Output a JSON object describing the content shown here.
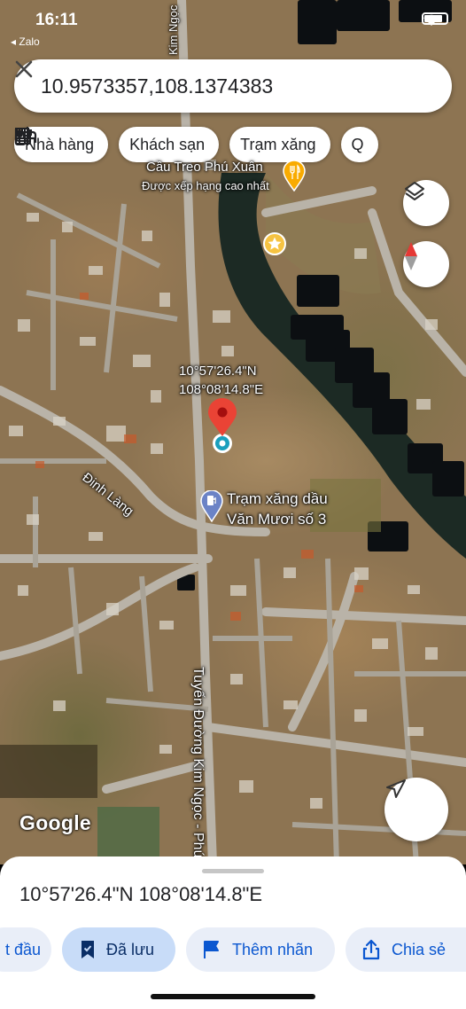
{
  "status_bar": {
    "time": "16:11",
    "back_app": "◂ Zalo"
  },
  "search": {
    "query": "10.9573357,108.1374383"
  },
  "chips": [
    {
      "label": "Nhà hàng",
      "icon": "restaurant-icon"
    },
    {
      "label": "Khách sạn",
      "icon": "hotel-icon"
    },
    {
      "label": "Trạm xăng",
      "icon": "gas-station-icon"
    },
    {
      "label": "Q",
      "icon": "coffee-icon"
    }
  ],
  "map": {
    "type": "satellite",
    "place": {
      "title": "Cầu Treo Phú Xuân",
      "subtitle": "Được xếp hạng cao nhất"
    },
    "pin_label": {
      "line1": "10°57'26.4\"N",
      "line2": "108°08'14.8\"E"
    },
    "gas_station": {
      "line1": "Trạm xăng dầu",
      "line2": "Văn Mươi số 3"
    },
    "streets": [
      "Đinh Làng",
      "Tuyến Đường Kim Ngọc - Phú",
      "Kim Ngọc"
    ],
    "attribution": "Google",
    "colors": {
      "pin": "#ea4335",
      "gas_pin": "#6b83c6",
      "place_pin": "#f9ab00",
      "accent": "#0b57d0"
    }
  },
  "sheet": {
    "coordinates": "10°57'26.4\"N 108°08'14.8\"E",
    "actions": [
      {
        "label": "t đầu",
        "icon": "directions-icon"
      },
      {
        "label": "Đã lưu",
        "icon": "bookmark-icon"
      },
      {
        "label": "Thêm nhãn",
        "icon": "flag-icon"
      },
      {
        "label": "Chia sẻ",
        "icon": "share-icon"
      }
    ]
  }
}
